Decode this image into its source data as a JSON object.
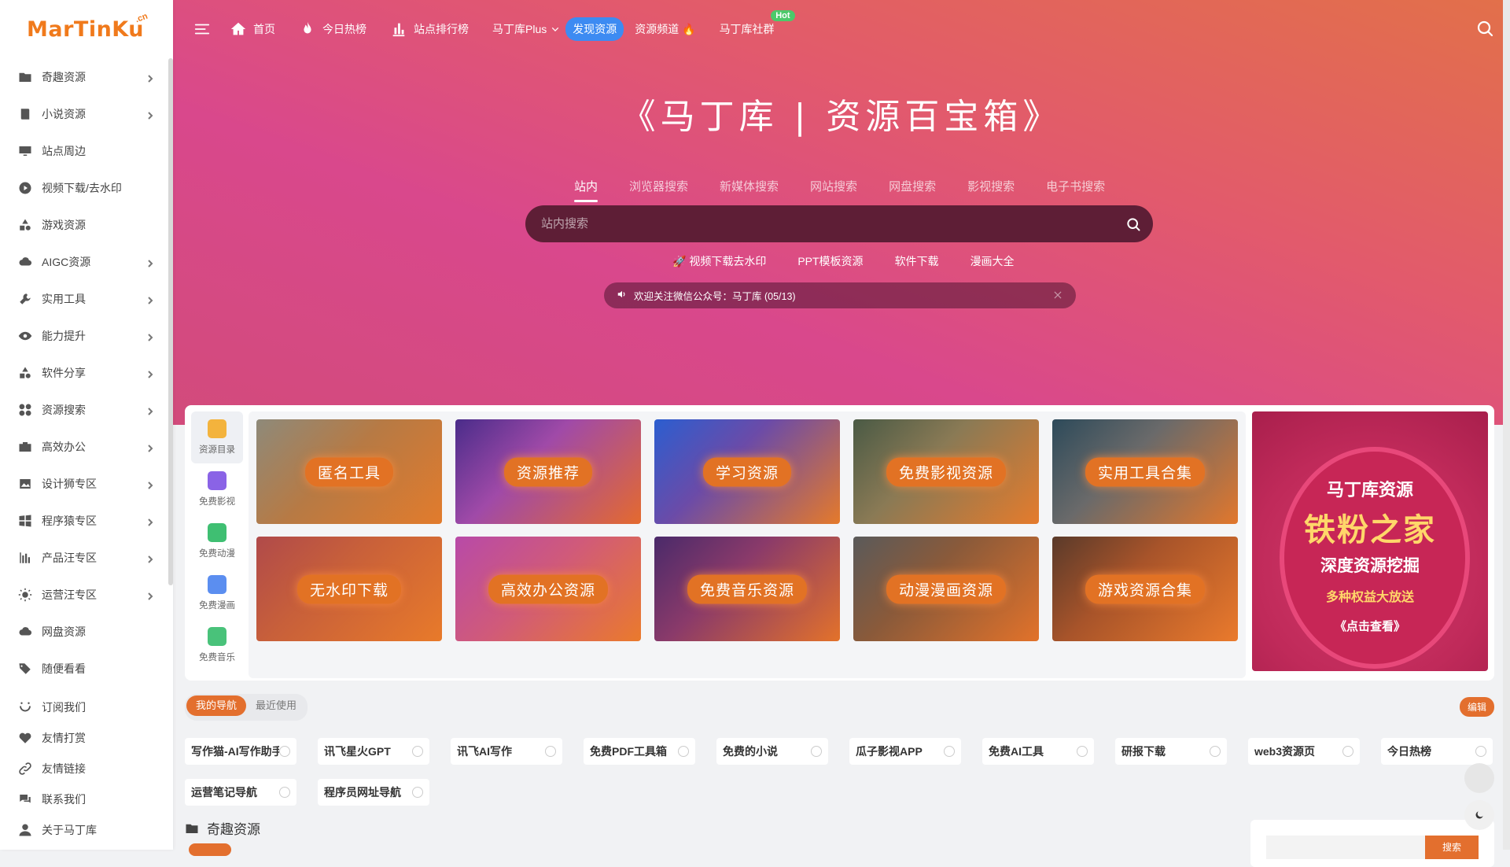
{
  "logo": {
    "text": "MarTinKu",
    "suffix": ".cn"
  },
  "sidebar": {
    "items": [
      {
        "label": "奇趣资源",
        "icon": "folder-icon",
        "arrow": true
      },
      {
        "label": "小说资源",
        "icon": "book-icon",
        "arrow": true
      },
      {
        "label": "站点周边",
        "icon": "monitor-icon",
        "arrow": false
      },
      {
        "label": "视频下载/去水印",
        "icon": "play-icon",
        "arrow": false
      },
      {
        "label": "游戏资源",
        "icon": "shapes-icon",
        "arrow": false
      },
      {
        "label": "AIGC资源",
        "icon": "cloud-icon",
        "arrow": true
      },
      {
        "label": "实用工具",
        "icon": "wrench-icon",
        "arrow": true
      },
      {
        "label": "能力提升",
        "icon": "eye-icon",
        "arrow": true
      },
      {
        "label": "软件分享",
        "icon": "shapes-icon",
        "arrow": true
      },
      {
        "label": "资源搜索",
        "icon": "grid-icon",
        "arrow": true
      },
      {
        "label": "高效办公",
        "icon": "briefcase-icon",
        "arrow": true
      },
      {
        "label": "设计狮专区",
        "icon": "image-icon",
        "arrow": true
      },
      {
        "label": "程序猿专区",
        "icon": "windows-icon",
        "arrow": true
      },
      {
        "label": "产品汪专区",
        "icon": "bar-chart-icon",
        "arrow": true
      },
      {
        "label": "运营汪专区",
        "icon": "sun-icon",
        "arrow": true
      },
      {
        "label": "网盘资源",
        "icon": "cloud-icon",
        "arrow": false
      },
      {
        "label": "随便看看",
        "icon": "tags-icon",
        "arrow": false
      }
    ],
    "footer_items": [
      {
        "label": "订阅我们",
        "icon": "smile-icon"
      },
      {
        "label": "友情打赏",
        "icon": "heart-icon"
      },
      {
        "label": "友情链接",
        "icon": "link-icon"
      },
      {
        "label": "联系我们",
        "icon": "chat-icon"
      },
      {
        "label": "关于马丁库",
        "icon": "user-icon"
      }
    ]
  },
  "topnav": {
    "home": "首页",
    "hot": "今日热榜",
    "rank": "站点排行榜",
    "plus": "马丁库Plus",
    "discover": "发现资源",
    "channel": "资源频道 🔥",
    "community": "马丁库社群",
    "community_badge": "Hot"
  },
  "hero": {
    "title": "《马丁库 | 资源百宝箱》",
    "search_tabs": [
      "站内",
      "浏览器搜索",
      "新媒体搜索",
      "网站搜索",
      "网盘搜索",
      "影视搜索",
      "电子书搜索"
    ],
    "search_placeholder": "站内搜索",
    "quick_links": [
      "🚀 视频下载去水印",
      "PPT模板资源",
      "软件下载",
      "漫画大全"
    ],
    "notice": "欢迎关注微信公众号：马丁库 (05/13)"
  },
  "categories": {
    "tabs": [
      {
        "label": "资源目录",
        "color": "#f3b33d"
      },
      {
        "label": "免费影视",
        "color": "#8a63e6"
      },
      {
        "label": "免费动漫",
        "color": "#3fbf72"
      },
      {
        "label": "免费漫画",
        "color": "#5b8ef0"
      },
      {
        "label": "免费音乐",
        "color": "#49c27a"
      }
    ],
    "tiles": [
      {
        "label": "匿名工具",
        "bg": "linear-gradient(135deg,#8e8a7a 0%,#b77a44 45%,#e27b2c 100%)"
      },
      {
        "label": "资源推荐",
        "bg": "linear-gradient(135deg,#4a2c8a 0%,#a04aa8 40%,#e46a2e 100%)"
      },
      {
        "label": "学习资源",
        "bg": "linear-gradient(135deg,#2b5ed0 0%,#6b4ba8 40%,#e57a2a 100%)"
      },
      {
        "label": "免费影视资源",
        "bg": "linear-gradient(135deg,#4a5a45 0%,#8a7a55 40%,#e57b2c 100%)"
      },
      {
        "label": "实用工具合集",
        "bg": "linear-gradient(135deg,#2d4a5a 0%,#6a6a6a 40%,#e2772c 100%)"
      },
      {
        "label": "无水印下载",
        "bg": "linear-gradient(135deg,#b04a4a 0%,#c8603a 40%,#e87a2a 100%)"
      },
      {
        "label": "高效办公资源",
        "bg": "linear-gradient(135deg,#b84aa8 0%,#d05a7a 45%,#ea7a2c 100%)"
      },
      {
        "label": "免费音乐资源",
        "bg": "linear-gradient(135deg,#4a2a6a 0%,#8a3a6a 40%,#e3722a 100%)"
      },
      {
        "label": "动漫漫画资源",
        "bg": "linear-gradient(135deg,#5a5a5a 0%,#8a5a3a 40%,#e2722a 100%)"
      },
      {
        "label": "游戏资源合集",
        "bg": "linear-gradient(135deg,#5a3a2a 0%,#a8542a 40%,#ea7a2c 100%)"
      }
    ],
    "promo": {
      "line1": "马丁库资源",
      "line2": "铁粉之家",
      "line3": "深度资源挖掘",
      "line4": "多种权益大放送",
      "line5": "《点击查看》"
    }
  },
  "mynav": {
    "tabs": [
      "我的导航",
      "最近使用"
    ],
    "edit": "编辑",
    "items": [
      "写作猫-AI写作助手",
      "讯飞星火GPT",
      "讯飞AI写作",
      "免费PDF工具箱",
      "免费的小说",
      "瓜子影视APP",
      "免费AI工具",
      "研报下载",
      "web3资源页",
      "今日热榜",
      "运营笔记导航",
      "程序员网址导航"
    ]
  },
  "section": {
    "title": "奇趣资源"
  },
  "widget": {
    "button": "搜索"
  },
  "colors": {
    "accent": "#e36f2e",
    "brand": "#f07a1c",
    "discover": "#3d8bf2"
  }
}
